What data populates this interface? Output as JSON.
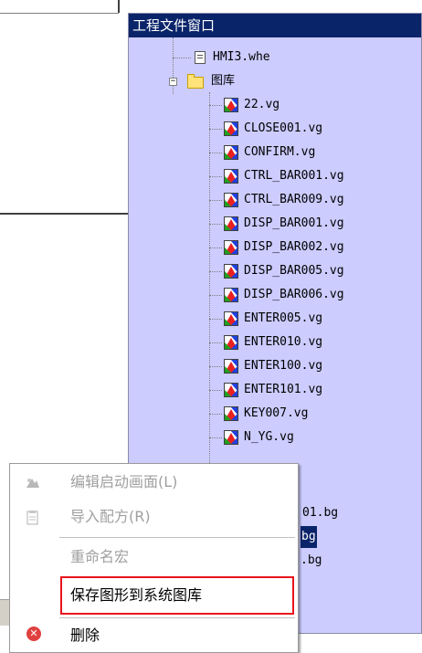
{
  "project_window": {
    "title": "工程文件窗口",
    "tree": {
      "top_file": "HMI3.whe",
      "folder": "图库",
      "folder_expander": "−",
      "files": [
        "22.vg",
        "CLOSE001.vg",
        "CONFIRM.vg",
        "CTRL_BAR001.vg",
        "CTRL_BAR009.vg",
        "DISP_BAR001.vg",
        "DISP_BAR002.vg",
        "DISP_BAR005.vg",
        "DISP_BAR006.vg",
        "ENTER005.vg",
        "ENTER010.vg",
        "ENTER100.vg",
        "ENTER101.vg",
        "KEY007.vg",
        "N_YG.vg"
      ],
      "partial_items": [
        "01.bg",
        "bg",
        ".bg"
      ]
    }
  },
  "context_menu": {
    "items": [
      {
        "label": "编辑启动画面(L)",
        "disabled": true,
        "icon": "edit-startup-icon"
      },
      {
        "label": "导入配方(R)",
        "disabled": true,
        "icon": "import-recipe-icon"
      },
      {
        "label": "重命名宏",
        "disabled": true,
        "icon": ""
      },
      {
        "label": "保存图形到系统图库",
        "disabled": false,
        "icon": ""
      },
      {
        "label": "删除",
        "disabled": false,
        "icon": "delete-icon"
      }
    ],
    "highlight_color": "#e8141c"
  },
  "colors": {
    "tree_background": "#ccccff",
    "title_bar": "#0a246a",
    "selection": "#0a246a"
  }
}
